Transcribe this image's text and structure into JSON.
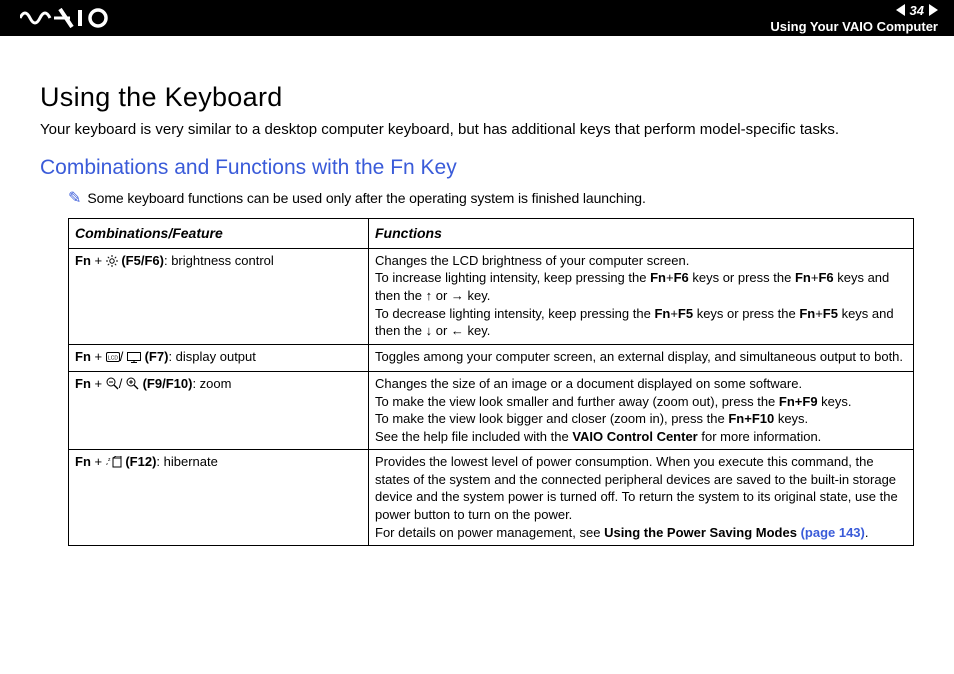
{
  "header": {
    "page_number": "34",
    "section": "Using Your VAIO Computer"
  },
  "title": "Using the Keyboard",
  "intro": "Your keyboard is very similar to a desktop computer keyboard, but has additional keys that perform model-specific tasks.",
  "subhead": "Combinations and Functions with the Fn Key",
  "note": "Some keyboard functions can be used only after the operating system is finished launching.",
  "table": {
    "head_combination": "Combinations/Feature",
    "head_function": "Functions",
    "rows": [
      {
        "comb_prefix": "Fn",
        "comb_plus": " + ",
        "comb_keys": "(F5/F6)",
        "comb_label": ": brightness control",
        "fn_line1": "Changes the LCD brightness of your computer screen.",
        "fn_line2a": "To increase lighting intensity, keep pressing the ",
        "fn_line2b": "Fn",
        "fn_line2c": "+",
        "fn_line2d": "F6",
        "fn_line2e": " keys or press the ",
        "fn_line2f": "Fn",
        "fn_line2g": "+",
        "fn_line2h": "F6",
        "fn_line2i": " keys and then the ",
        "fn_line2j": " or ",
        "fn_line2k": " key.",
        "fn_line3a": "To decrease lighting intensity, keep pressing the ",
        "fn_line3b": "Fn",
        "fn_line3c": "+",
        "fn_line3d": "F5",
        "fn_line3e": " keys or press the ",
        "fn_line3f": "Fn",
        "fn_line3g": "+",
        "fn_line3h": "F5",
        "fn_line3i": " keys and then the ",
        "fn_line3j": " or ",
        "fn_line3k": " key."
      },
      {
        "comb_prefix": "Fn",
        "comb_plus": " + ",
        "comb_sep": "/",
        "comb_keys": "(F7)",
        "comb_label": ": display output",
        "fn_line1": "Toggles among your computer screen, an external display, and simultaneous output to both."
      },
      {
        "comb_prefix": "Fn",
        "comb_plus": " + ",
        "comb_sep": "/",
        "comb_keys": "(F9/F10)",
        "comb_label": ": zoom",
        "fn_line1": "Changes the size of an image or a document displayed on some software.",
        "fn_line2a": "To make the view look smaller and further away (zoom out), press the ",
        "fn_line2b": "Fn+F9",
        "fn_line2c": " keys.",
        "fn_line3a": "To make the view look bigger and closer (zoom in), press the ",
        "fn_line3b": "Fn+F10",
        "fn_line3c": " keys.",
        "fn_line4a": "See the help file included with the ",
        "fn_line4b": "VAIO Control Center",
        "fn_line4c": " for more information."
      },
      {
        "comb_prefix": "Fn",
        "comb_plus": " + ",
        "comb_keys": "(F12)",
        "comb_label": ": hibernate",
        "fn_line1": "Provides the lowest level of power consumption. When you execute this command, the states of the system and the connected peripheral devices are saved to the built-in storage device and the system power is turned off. To return the system to its original state, use the power button to turn on the power.",
        "fn_line2a": "For details on power management, see ",
        "fn_line2b": "Using the Power Saving Modes ",
        "fn_link": "(page 143)",
        "fn_line2c": "."
      }
    ]
  }
}
